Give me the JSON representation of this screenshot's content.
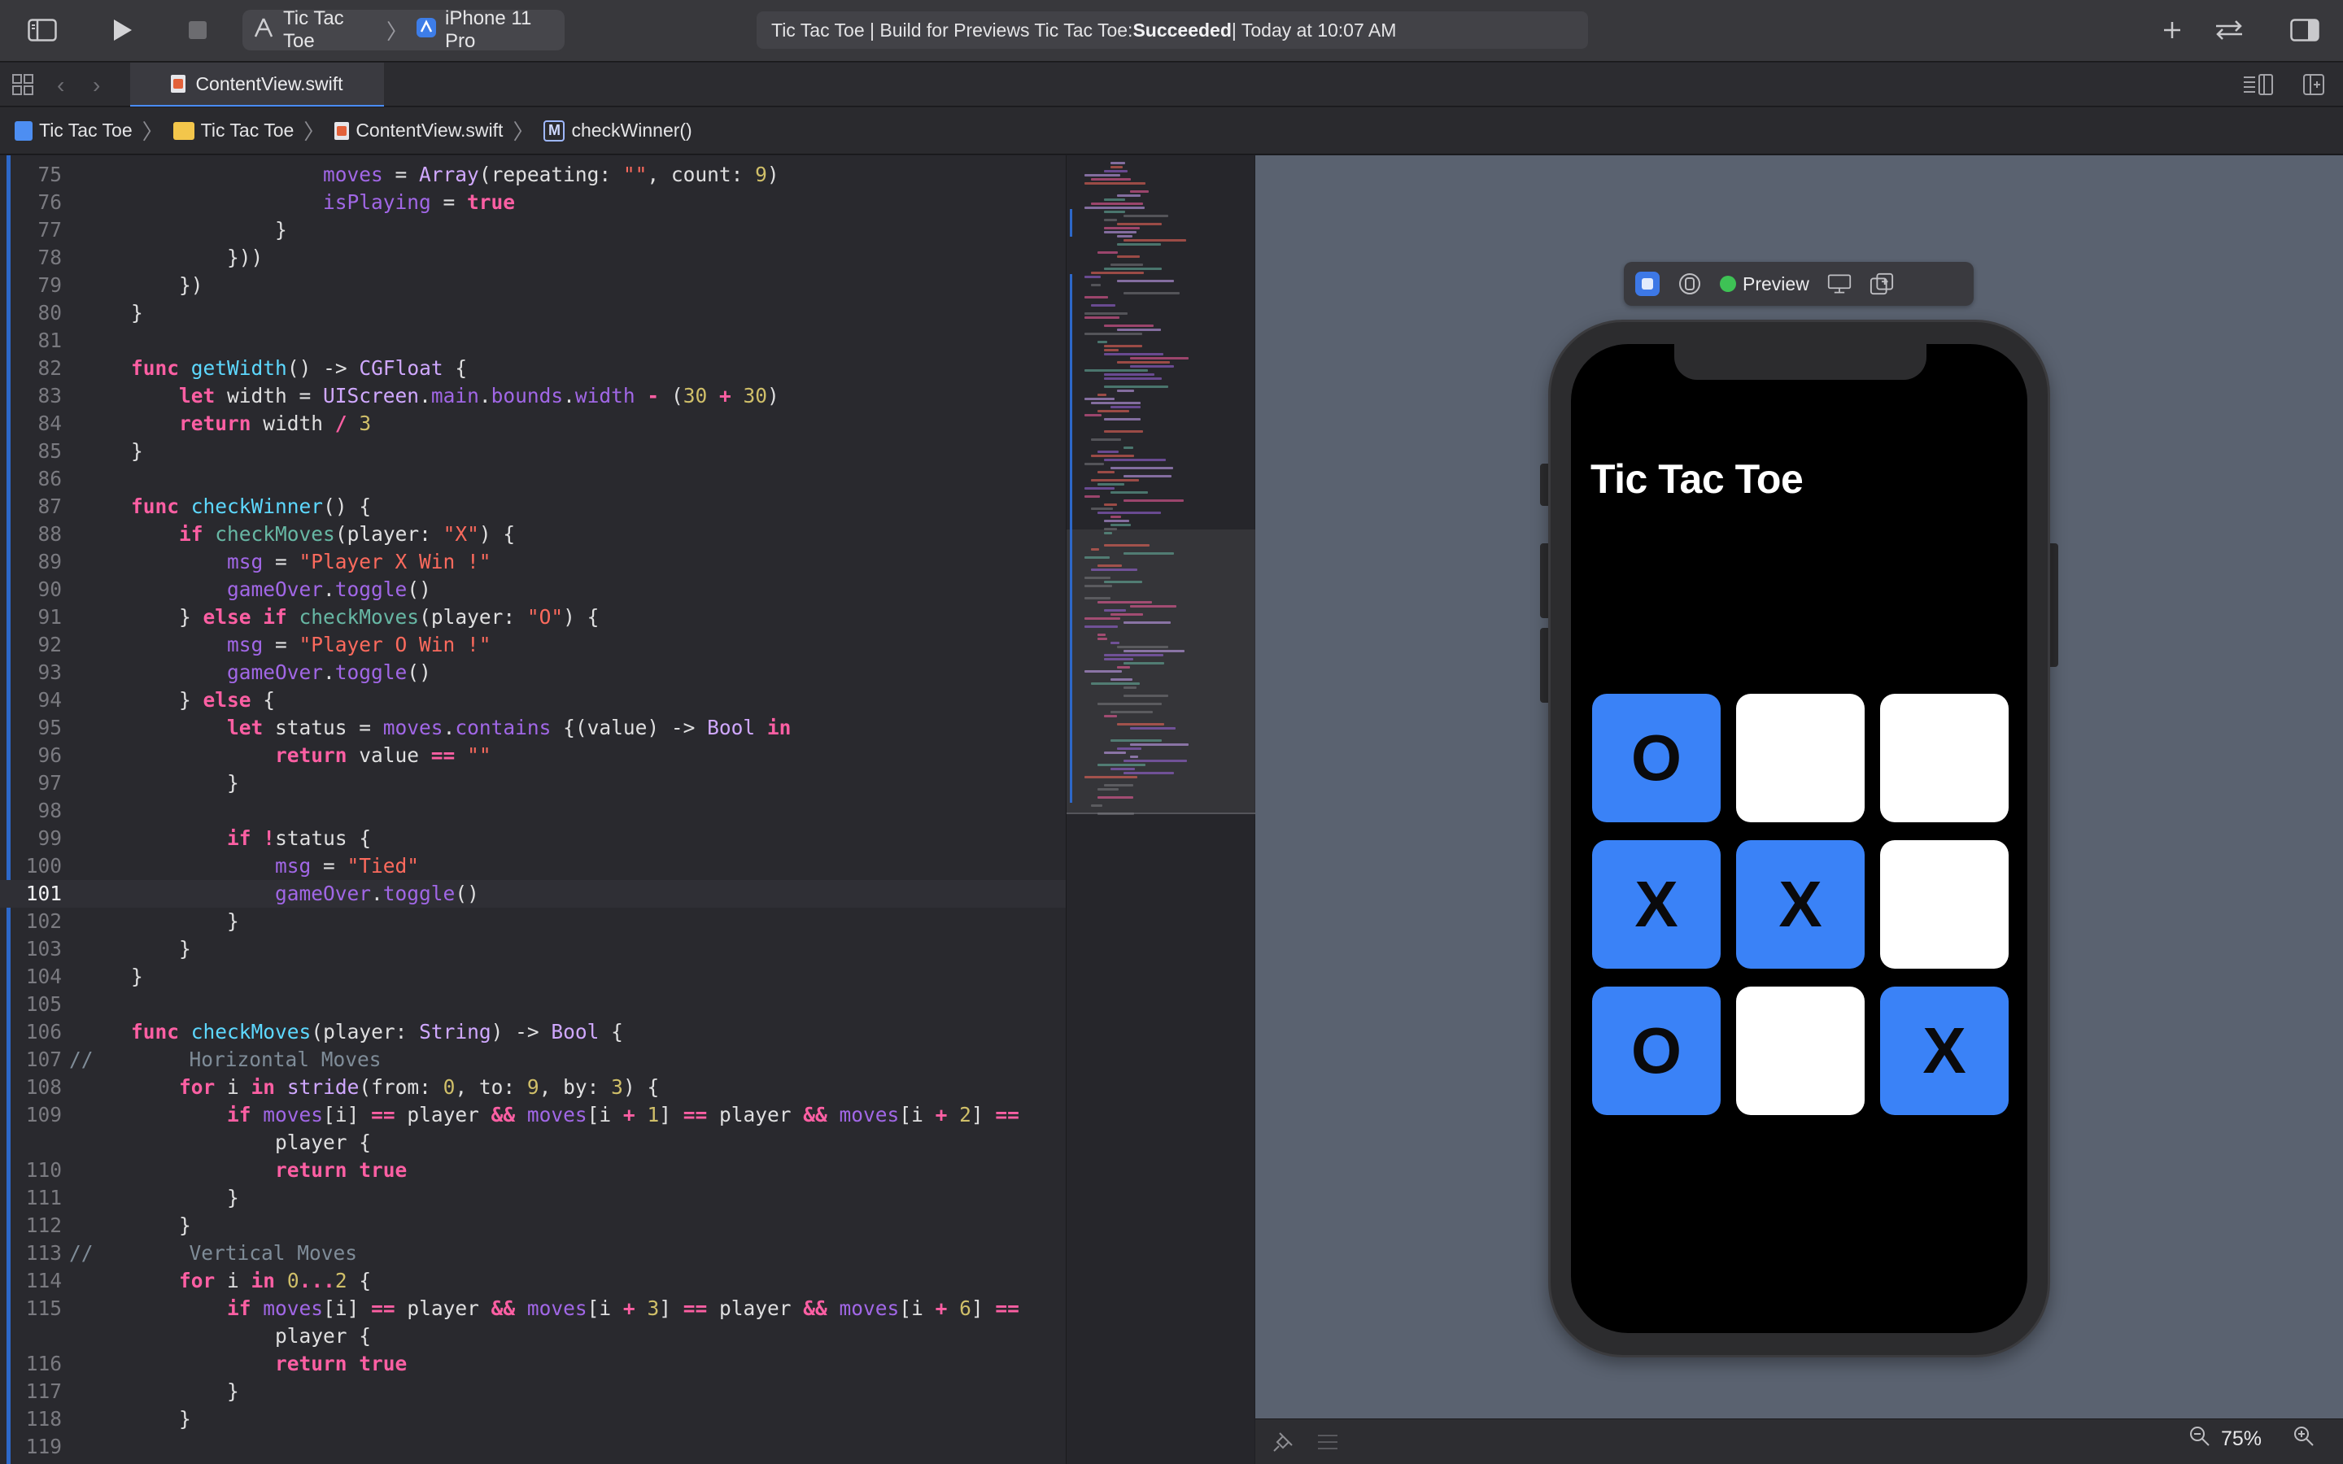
{
  "toolbar": {
    "scheme": "Tic Tac Toe",
    "device": "iPhone 11 Pro",
    "activity_prefix": "Tic Tac Toe | Build for Previews Tic Tac Toe: ",
    "activity_status": "Succeeded",
    "activity_suffix": " | Today at 10:07 AM"
  },
  "tab": {
    "label": "ContentView.swift"
  },
  "jumpbar": {
    "project": "Tic Tac Toe",
    "folder": "Tic Tac Toe",
    "file": "ContentView.swift",
    "symbol": "checkWinner()",
    "symbol_badge": "M"
  },
  "editor": {
    "current_line": "101",
    "lines": [
      {
        "n": "75",
        "html": "                <span class=\"p\">moves</span> = <span class=\"t\">Array</span>(repeating: <span class=\"s\">\"\"</span>, count: <span class=\"n\">9</span>)"
      },
      {
        "n": "76",
        "html": "                <span class=\"p\">isPlaying</span> = <span class=\"k\">true</span>"
      },
      {
        "n": "77",
        "html": "            }"
      },
      {
        "n": "78",
        "html": "        }))"
      },
      {
        "n": "79",
        "html": "    })"
      },
      {
        "n": "80",
        "html": "}"
      },
      {
        "n": "81",
        "html": ""
      },
      {
        "n": "82",
        "html": "<span class=\"k\">func</span> <span class=\"d\">getWidth</span>() -> <span class=\"t\">CGFloat</span> {"
      },
      {
        "n": "83",
        "html": "    <span class=\"k\">let</span> width = <span class=\"t\">UIScreen</span>.<span class=\"p\">main</span>.<span class=\"p\">bounds</span>.<span class=\"p\">width</span> <span class=\"k\">-</span> (<span class=\"n\">30</span> <span class=\"k\">+</span> <span class=\"n\">30</span>)"
      },
      {
        "n": "84",
        "html": "    <span class=\"k\">return</span> width <span class=\"k\">/</span> <span class=\"n\">3</span>"
      },
      {
        "n": "85",
        "html": "}"
      },
      {
        "n": "86",
        "html": ""
      },
      {
        "n": "87",
        "html": "<span class=\"k\">func</span> <span class=\"d\">checkWinner</span>() {"
      },
      {
        "n": "88",
        "html": "    <span class=\"k\">if</span> <span class=\"f\">checkMoves</span>(player: <span class=\"s\">\"X\"</span>) {"
      },
      {
        "n": "89",
        "html": "        <span class=\"p\">msg</span> = <span class=\"s\">\"Player X Win !\"</span>"
      },
      {
        "n": "90",
        "html": "        <span class=\"p\">gameOver</span>.<span class=\"p\">toggle</span>()"
      },
      {
        "n": "91",
        "html": "    } <span class=\"k\">else if</span> <span class=\"f\">checkMoves</span>(player: <span class=\"s\">\"O\"</span>) {"
      },
      {
        "n": "92",
        "html": "        <span class=\"p\">msg</span> = <span class=\"s\">\"Player O Win !\"</span>"
      },
      {
        "n": "93",
        "html": "        <span class=\"p\">gameOver</span>.<span class=\"p\">toggle</span>()"
      },
      {
        "n": "94",
        "html": "    } <span class=\"k\">else</span> {"
      },
      {
        "n": "95",
        "html": "        <span class=\"k\">let</span> status = <span class=\"p\">moves</span>.<span class=\"p\">contains</span> {(value) -> <span class=\"t\">Bool</span> <span class=\"k\">in</span>"
      },
      {
        "n": "96",
        "html": "            <span class=\"k\">return</span> value <span class=\"k\">==</span> <span class=\"s\">\"\"</span>"
      },
      {
        "n": "97",
        "html": "        }"
      },
      {
        "n": "98",
        "html": ""
      },
      {
        "n": "99",
        "html": "        <span class=\"k\">if</span> <span class=\"k\">!</span>status {"
      },
      {
        "n": "100",
        "html": "            <span class=\"p\">msg</span> = <span class=\"s\">\"Tied\"</span>"
      },
      {
        "n": "101",
        "html": "            <span class=\"p\">gameOver</span>.<span class=\"p\">toggle</span>()"
      },
      {
        "n": "102",
        "html": "        }"
      },
      {
        "n": "103",
        "html": "    }"
      },
      {
        "n": "104",
        "html": "}"
      },
      {
        "n": "105",
        "html": ""
      },
      {
        "n": "106",
        "html": "<span class=\"k\">func</span> <span class=\"d\">checkMoves</span>(player: <span class=\"t\">String</span>) -> <span class=\"t\">Bool</span> {"
      },
      {
        "n": "107",
        "html": "<span class=\"c\">//        Horizontal Moves</span>",
        "indent": "-2"
      },
      {
        "n": "108",
        "html": "    <span class=\"k\">for</span> i <span class=\"k\">in</span> <span class=\"t\">stride</span>(from: <span class=\"n\">0</span>, to: <span class=\"n\">9</span>, by: <span class=\"n\">3</span>) {"
      },
      {
        "n": "109",
        "html": "        <span class=\"k\">if</span> <span class=\"p\">moves</span>[i] <span class=\"k\">==</span> player <span class=\"k\">&amp;&amp;</span> <span class=\"p\">moves</span>[i <span class=\"k\">+</span> <span class=\"n\">1</span>] <span class=\"k\">==</span> player <span class=\"k\">&amp;&amp;</span> <span class=\"p\">moves</span>[i <span class=\"k\">+</span> <span class=\"n\">2</span>] <span class=\"k\">==</span>"
      },
      {
        "n": "",
        "html": "            player {"
      },
      {
        "n": "110",
        "html": "            <span class=\"k\">return</span> <span class=\"k\">true</span>"
      },
      {
        "n": "111",
        "html": "        }"
      },
      {
        "n": "112",
        "html": "    }"
      },
      {
        "n": "113",
        "html": "<span class=\"c\">//        Vertical Moves</span>",
        "indent": "-2"
      },
      {
        "n": "114",
        "html": "    <span class=\"k\">for</span> i <span class=\"k\">in</span> <span class=\"n\">0</span><span class=\"k\">...</span><span class=\"n\">2</span> {"
      },
      {
        "n": "115",
        "html": "        <span class=\"k\">if</span> <span class=\"p\">moves</span>[i] <span class=\"k\">==</span> player <span class=\"k\">&amp;&amp;</span> <span class=\"p\">moves</span>[i <span class=\"k\">+</span> <span class=\"n\">3</span>] <span class=\"k\">==</span> player <span class=\"k\">&amp;&amp;</span> <span class=\"p\">moves</span>[i <span class=\"k\">+</span> <span class=\"n\">6</span>] <span class=\"k\">==</span>"
      },
      {
        "n": "",
        "html": "            player {"
      },
      {
        "n": "116",
        "html": "            <span class=\"k\">return</span> <span class=\"k\">true</span>"
      },
      {
        "n": "117",
        "html": "        }"
      },
      {
        "n": "118",
        "html": "    }"
      },
      {
        "n": "119",
        "html": ""
      }
    ]
  },
  "preview": {
    "label": "Preview",
    "app_title": "Tic Tac Toe",
    "board": [
      "O",
      "",
      "",
      "X",
      "X",
      "",
      "O",
      "",
      "X"
    ],
    "zoom": "75%"
  },
  "colors": {
    "accent": "#3a82f7",
    "keyword": "#fc5fa3",
    "string": "#fc6a5d",
    "number": "#d0bf69",
    "status_green": "#3ec255"
  }
}
